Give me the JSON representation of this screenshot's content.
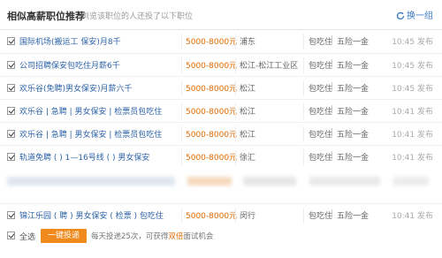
{
  "header": {
    "title": "相似高薪职位推荐",
    "subtitle": "浏览该职位的人还投了以下职位",
    "refresh_label": "换一组"
  },
  "jobs": [
    {
      "title": "国际机场(搬运工 保安)月8千",
      "salary": "5000-8000元",
      "location": "浦东",
      "benefit1": "包吃住",
      "benefit2": "五险一金",
      "time": "10:45 发布"
    },
    {
      "title": "公司招聘保安包吃住月薪6千",
      "salary": "5000-8000元",
      "location": "松江-松江工业区",
      "benefit1": "包吃住",
      "benefit2": "五险一金",
      "time": "10:45 发布"
    },
    {
      "title": "欢乐谷(免聘)男女保安)月薪六千",
      "salary": "5000-8000元",
      "location": "松江",
      "benefit1": "包吃住",
      "benefit2": "五险一金",
      "time": "10:45 发布"
    },
    {
      "title": "欢乐谷 | 急聘 | 男女保安 | 检票员包吃住",
      "salary": "5000-8000元",
      "location": "松江",
      "benefit1": "包吃住",
      "benefit2": "五险一金",
      "time": "10:41 发布"
    },
    {
      "title": "欢乐谷 | 急聘 | 男女保安 | 检票员包吃住",
      "salary": "5000-8000元",
      "location": "松江",
      "benefit1": "包吃住",
      "benefit2": "五险一金",
      "time": "10:41 发布"
    },
    {
      "title": "轨道免聘 ( ) 1—16号线 ( ) 男女保安",
      "salary": "5000-8000元",
      "location": "徐汇",
      "benefit1": "包吃住",
      "benefit2": "五险一金",
      "time": "10:41 发布"
    },
    {
      "title": "锦江乐园 ( 聘 ) 男女保安 ( 检票 ) 包吃住",
      "salary": "5000-8000元",
      "location": "闵行",
      "benefit1": "包吃住",
      "benefit2": "五险一金",
      "time": "10:41 发布"
    }
  ],
  "footer": {
    "select_all_label": "全选",
    "apply_button_label": "一键投递",
    "note_prefix": "每天投递25次，可获得",
    "note_highlight": "双倍",
    "note_suffix": "面试机会"
  },
  "colors": {
    "job_link": "#2c62a8",
    "salary": "#e06a00",
    "apply_button": "#f08a1c",
    "refresh_link": "#3a7ac8"
  },
  "icons": {
    "refresh": "refresh-icon",
    "checkbox": "checkbox-checked-icon"
  }
}
